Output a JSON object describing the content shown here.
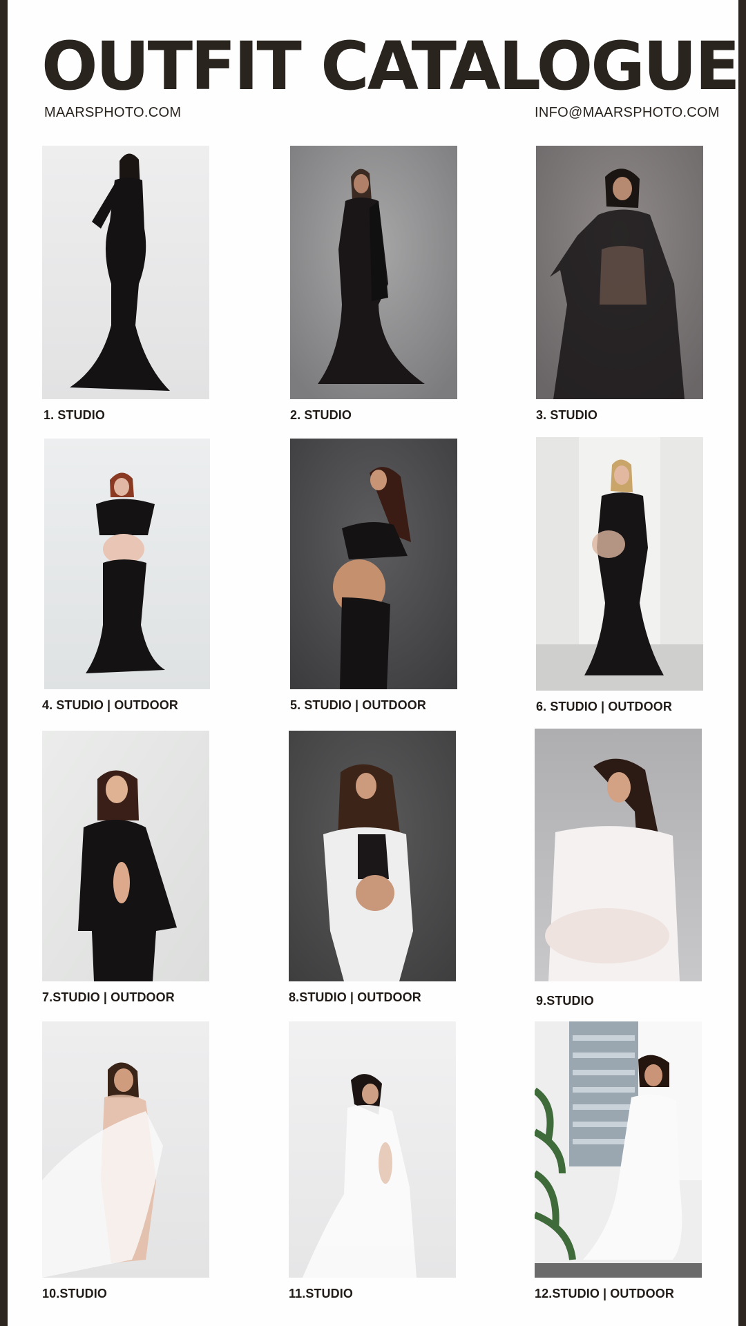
{
  "header": {
    "title": "OUTFIT CATALOGUE",
    "website": "MAARSPHOTO.COM",
    "email": "INFO@MAARSPHOTO.COM"
  },
  "colors": {
    "border": "#2d2520",
    "text": "#2a241f"
  },
  "outfits": [
    {
      "caption": "1.  STUDIO",
      "backdrop": "white",
      "outfit": "black long-sleeve mermaid gown"
    },
    {
      "caption": "2. STUDIO",
      "backdrop": "grey",
      "outfit": "black cape mermaid gown"
    },
    {
      "caption": "3. STUDIO",
      "backdrop": "grey",
      "outfit": "black sheer tulle dress"
    },
    {
      "caption": "4. STUDIO | OUTDOOR",
      "backdrop": "white",
      "outfit": "black ruffle top and mermaid skirt"
    },
    {
      "caption": "5. STUDIO | OUTDOOR",
      "backdrop": "dark grey",
      "outfit": "black crop top and skirt"
    },
    {
      "caption": "6. STUDIO | OUTDOOR",
      "backdrop": "white",
      "outfit": "black sheer bodysuit gown"
    },
    {
      "caption": "7.STUDIO | OUTDOOR",
      "backdrop": "white",
      "outfit": "black suit"
    },
    {
      "caption": "8.STUDIO | OUTDOOR",
      "backdrop": "dark grey",
      "outfit": "white suit"
    },
    {
      "caption": "9.STUDIO",
      "backdrop": "grey",
      "outfit": "white chiffon dress"
    },
    {
      "caption": "10.STUDIO",
      "backdrop": "white",
      "outfit": "white sheer fabric wrap"
    },
    {
      "caption": "11.STUDIO",
      "backdrop": "white",
      "outfit": "white sheer fabric wrap"
    },
    {
      "caption": "12.STUDIO | OUTDOOR",
      "backdrop": "window",
      "outfit": "white flowing dress"
    }
  ]
}
